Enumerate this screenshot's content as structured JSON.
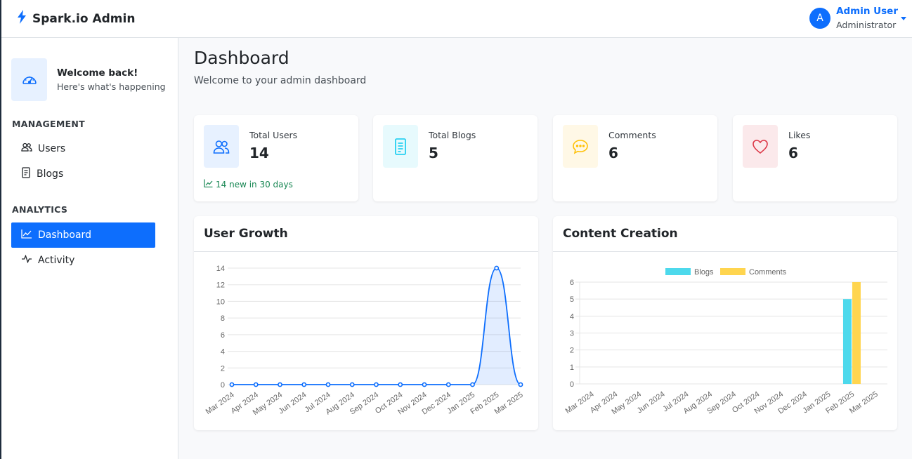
{
  "app": {
    "brand": "Spark.io Admin"
  },
  "user": {
    "initial": "A",
    "name": "Admin User",
    "role": "Administrator"
  },
  "sidebar": {
    "welcome_title": "Welcome back!",
    "welcome_sub": "Here's what's happening",
    "sections": [
      {
        "label": "MANAGEMENT",
        "items": [
          {
            "label": "Users",
            "icon": "users-icon"
          },
          {
            "label": "Blogs",
            "icon": "document-icon"
          }
        ]
      },
      {
        "label": "ANALYTICS",
        "items": [
          {
            "label": "Dashboard",
            "icon": "chart-line-icon",
            "active": true
          },
          {
            "label": "Activity",
            "icon": "activity-icon"
          }
        ]
      }
    ]
  },
  "page": {
    "title": "Dashboard",
    "subtitle": "Welcome to your admin dashboard"
  },
  "stats": [
    {
      "label": "Total Users",
      "value": "14",
      "trend": "14 new in 30 days",
      "icon": "users-icon",
      "color": "#0d6efd",
      "bg": "#e7f1ff"
    },
    {
      "label": "Total Blogs",
      "value": "5",
      "icon": "document-icon",
      "color": "#0dcaf0",
      "bg": "#e7fafd"
    },
    {
      "label": "Comments",
      "value": "6",
      "icon": "chat-icon",
      "color": "#ffc107",
      "bg": "#fff8e6"
    },
    {
      "label": "Likes",
      "value": "6",
      "icon": "heart-icon",
      "color": "#dc3545",
      "bg": "#fbe9eb"
    }
  ],
  "colors": {
    "primary": "#0d6efd",
    "success": "#198754",
    "blogs": "#4dd9ec",
    "comments": "#ffd54f"
  },
  "chart_data": [
    {
      "type": "line",
      "title": "User Growth",
      "categories": [
        "Mar 2024",
        "Apr 2024",
        "May 2024",
        "Jun 2024",
        "Jul 2024",
        "Aug 2024",
        "Sep 2024",
        "Oct 2024",
        "Nov 2024",
        "Dec 2024",
        "Jan 2025",
        "Feb 2025",
        "Mar 2025"
      ],
      "series": [
        {
          "values": [
            0,
            0,
            0,
            0,
            0,
            0,
            0,
            0,
            0,
            0,
            0,
            14,
            0
          ]
        }
      ],
      "ylim": [
        0,
        14
      ],
      "yticks": [
        0,
        2,
        4,
        6,
        8,
        10,
        12,
        14
      ],
      "grid": true
    },
    {
      "type": "bar",
      "title": "Content Creation",
      "categories": [
        "Mar 2024",
        "Apr 2024",
        "May 2024",
        "Jun 2024",
        "Jul 2024",
        "Aug 2024",
        "Sep 2024",
        "Oct 2024",
        "Nov 2024",
        "Dec 2024",
        "Jan 2025",
        "Feb 2025",
        "Mar 2025"
      ],
      "series": [
        {
          "name": "Blogs",
          "values": [
            0,
            0,
            0,
            0,
            0,
            0,
            0,
            0,
            0,
            0,
            0,
            5,
            0
          ]
        },
        {
          "name": "Comments",
          "values": [
            0,
            0,
            0,
            0,
            0,
            0,
            0,
            0,
            0,
            0,
            0,
            6,
            0
          ]
        }
      ],
      "ylim": [
        0,
        6
      ],
      "yticks": [
        0,
        1,
        2,
        3,
        4,
        5,
        6
      ],
      "legend": "top-center",
      "grid": true
    }
  ]
}
